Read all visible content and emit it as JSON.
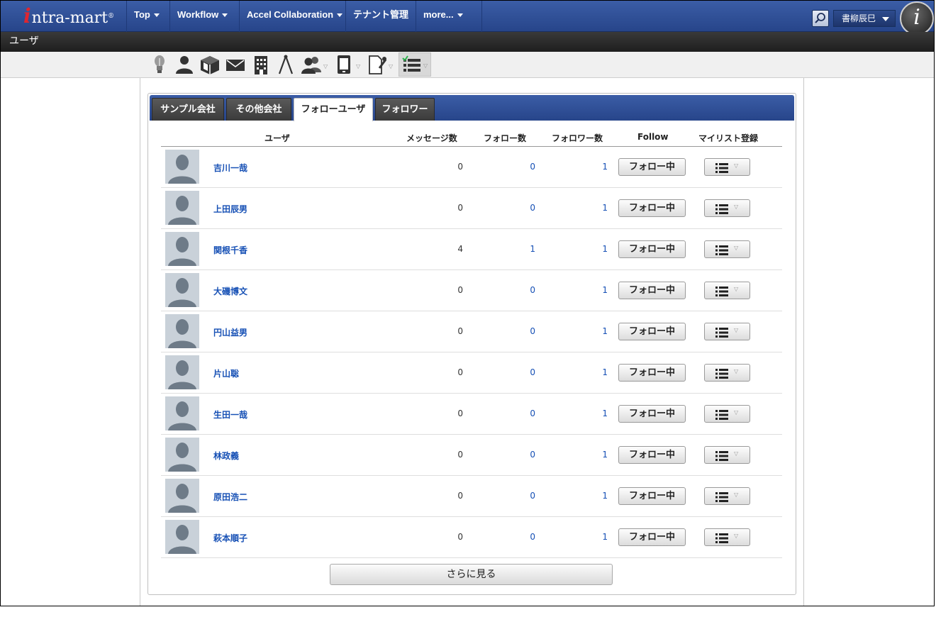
{
  "header": {
    "logo_text": "ntra-mart",
    "logo_mark": "i",
    "logo_reg": "®",
    "nav": [
      "Top",
      "Workflow",
      "Accel Collaboration",
      "テナント管理",
      "more..."
    ],
    "user_name": "書柳辰巳",
    "brand_glyph": "i",
    "search_icon": "search-icon"
  },
  "page": {
    "title": "ユーザ"
  },
  "toolbar": {
    "icons": [
      "lightbulb-icon",
      "user-icon",
      "cube-icon",
      "mail-icon",
      "building-icon",
      "compass-icon",
      "group-icon",
      "device-icon",
      "edit-pin-icon",
      "list-icon"
    ]
  },
  "tabs": [
    "サンプル会社",
    "その他会社",
    "フォローユーザ",
    "フォロワー"
  ],
  "active_tab": "フォローユーザ",
  "table": {
    "headers": {
      "user": "ユーザ",
      "messages": "メッセージ数",
      "follows": "フォロー数",
      "followers": "フォロワー数",
      "follow": "Follow",
      "mylist": "マイリスト登録"
    },
    "follow_button_label": "フォロー中",
    "rows": [
      {
        "name": "吉川一哉",
        "messages": "0",
        "follows": "0",
        "followers": "1"
      },
      {
        "name": "上田辰男",
        "messages": "0",
        "follows": "0",
        "followers": "1"
      },
      {
        "name": "関根千香",
        "messages": "4",
        "follows": "1",
        "followers": "1"
      },
      {
        "name": "大磯博文",
        "messages": "0",
        "follows": "0",
        "followers": "1"
      },
      {
        "name": "円山益男",
        "messages": "0",
        "follows": "0",
        "followers": "1"
      },
      {
        "name": "片山聡",
        "messages": "0",
        "follows": "0",
        "followers": "1"
      },
      {
        "name": "生田一哉",
        "messages": "0",
        "follows": "0",
        "followers": "1"
      },
      {
        "name": "林政義",
        "messages": "0",
        "follows": "0",
        "followers": "1"
      },
      {
        "name": "原田浩二",
        "messages": "0",
        "follows": "0",
        "followers": "1"
      },
      {
        "name": "萩本順子",
        "messages": "0",
        "follows": "0",
        "followers": "1"
      }
    ]
  },
  "more_button_label": "さらに見る",
  "colors": {
    "nav_blue": "#2f4f97",
    "link_blue": "#1650b5",
    "title_bar": "#262626"
  }
}
